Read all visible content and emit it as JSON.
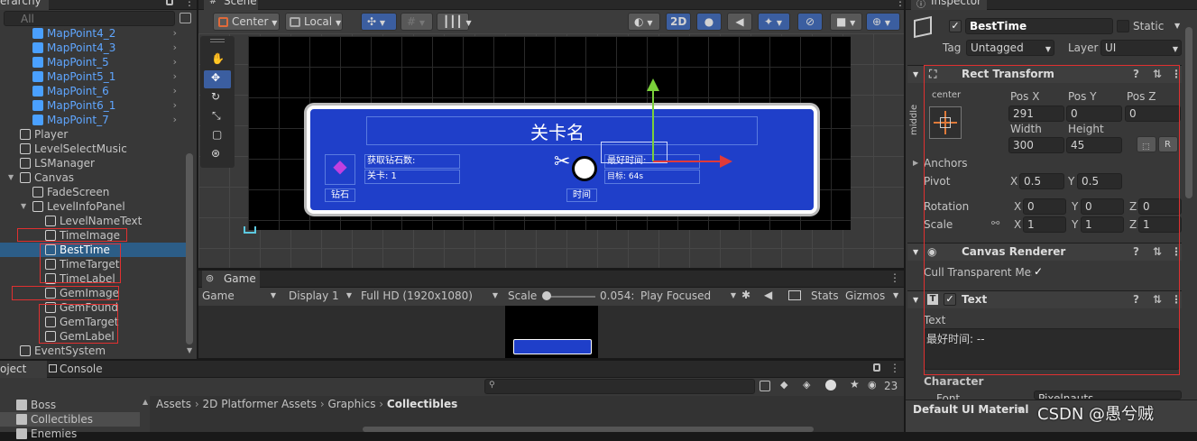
{
  "hierarchy": {
    "title": "erarchy",
    "search_placeholder": "All",
    "items": [
      {
        "label": "MapPoint4_2",
        "blue": true,
        "arrow": true
      },
      {
        "label": "MapPoint4_3",
        "blue": true,
        "arrow": true
      },
      {
        "label": "MapPoint_5",
        "blue": true,
        "arrow": true
      },
      {
        "label": "MapPoint5_1",
        "blue": true,
        "arrow": true
      },
      {
        "label": "MapPoint_6",
        "blue": true,
        "arrow": true
      },
      {
        "label": "MapPoint6_1",
        "blue": true,
        "arrow": true
      },
      {
        "label": "MapPoint_7",
        "blue": true,
        "arrow": true
      },
      {
        "label": "Player"
      },
      {
        "label": "LevelSelectMusic"
      },
      {
        "label": "LSManager"
      },
      {
        "label": "Canvas"
      },
      {
        "label": "FadeScreen"
      },
      {
        "label": "LevelInfoPanel"
      },
      {
        "label": "LevelNameText"
      },
      {
        "label": "TimeImage"
      },
      {
        "label": "BestTime"
      },
      {
        "label": "TimeTarget"
      },
      {
        "label": "TimeLabel"
      },
      {
        "label": "GemImage"
      },
      {
        "label": "GemFound"
      },
      {
        "label": "GemTarget"
      },
      {
        "label": "GemLabel"
      },
      {
        "label": "EventSystem"
      }
    ]
  },
  "scene": {
    "tab": "Scene",
    "pivot": "Center",
    "space": "Local",
    "mode2d": "2D",
    "panel": {
      "title": "关卡名",
      "gem_found": "获取钻石数:",
      "level": "关卡: 1",
      "gem_label": "钻石",
      "best_time": "最好时间:",
      "target": "目标: 64s",
      "time_label": "时间"
    }
  },
  "game": {
    "tab": "Game",
    "view": "Game",
    "display": "Display 1",
    "resolution": "Full HD (1920x1080)",
    "scale_label": "Scale",
    "scale_value": "0.054:",
    "play_focused": "Play Focused",
    "stats": "Stats",
    "gizmos": "Gizmos"
  },
  "project": {
    "tab_project": "oject",
    "tab_console": "Console",
    "folders": [
      "Boss",
      "Collectibles",
      "Enemies"
    ],
    "breadcrumb": [
      "Assets",
      "2D Platformer Assets",
      "Graphics",
      "Collectibles"
    ],
    "count": "23"
  },
  "inspector": {
    "tab": "Inspector",
    "name": "BestTime",
    "static_label": "Static",
    "tag_label": "Tag",
    "tag": "Untagged",
    "layer_label": "Layer",
    "layer": "UI",
    "rect": {
      "title": "Rect Transform",
      "anchor_h": "center",
      "anchor_v": "middle",
      "pos_x_label": "Pos X",
      "pos_y_label": "Pos Y",
      "pos_z_label": "Pos Z",
      "pos_x": "291",
      "pos_y": "0",
      "pos_z": "0",
      "width_label": "Width",
      "height_label": "Height",
      "width": "300",
      "height": "45",
      "r": "R",
      "anchors": "Anchors",
      "pivot": "Pivot",
      "pivot_x": "0.5",
      "pivot_y": "0.5",
      "rotation": "Rotation",
      "rot_x": "0",
      "rot_y": "0",
      "rot_z": "0",
      "scale": "Scale",
      "scale_x": "1",
      "scale_y": "1",
      "scale_z": "1",
      "x": "X",
      "y": "Y",
      "z": "Z"
    },
    "canvas_renderer": {
      "title": "Canvas Renderer",
      "cull": "Cull Transparent Mes"
    },
    "text": {
      "title": "Text",
      "text_label": "Text",
      "text_value": "最好时间: --",
      "character": "Character",
      "font": "Font",
      "font_value": "Pixelnauts"
    },
    "material": "Default UI Material"
  },
  "watermark": "CSDN @愚兮贼",
  "colors": {
    "selection": "#2c5d87",
    "prefab_blue": "#5fa6ff",
    "panel_blue": "#1f3fc9",
    "highlight_box": "#e03030",
    "tool_active": "#3b5ea0"
  }
}
